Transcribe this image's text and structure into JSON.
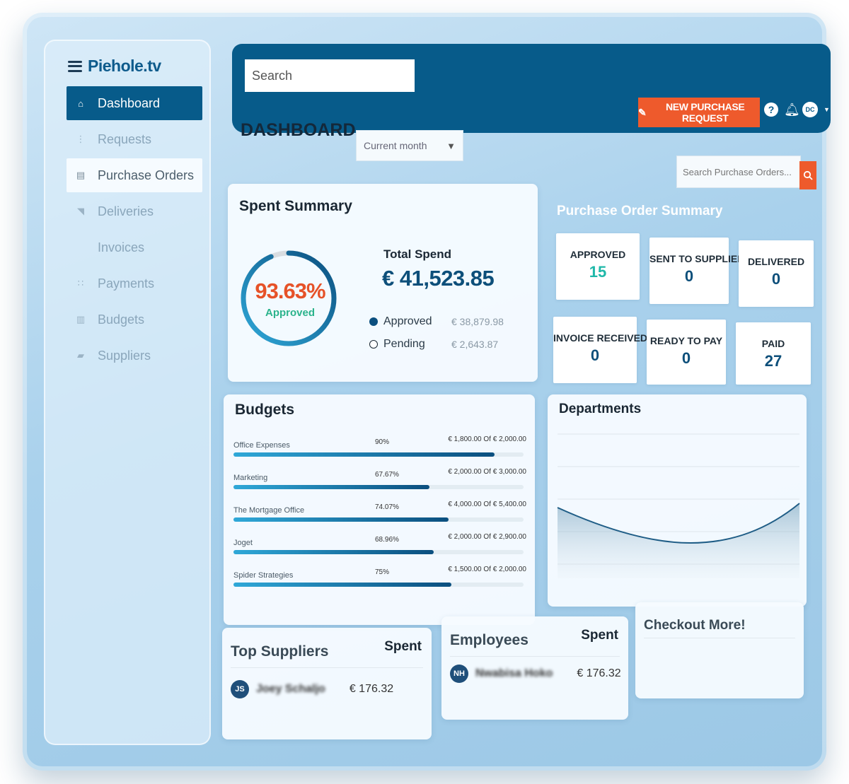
{
  "sidebar": {
    "brand": "Piehole.tv",
    "items": [
      {
        "label": "Dashboard",
        "icon": "home-icon",
        "glyph": "⌂"
      },
      {
        "label": "Requests",
        "icon": "requests-icon",
        "glyph": "⋮"
      },
      {
        "label": "Purchase Orders",
        "icon": "document-icon",
        "glyph": "▤"
      },
      {
        "label": "Deliveries",
        "icon": "deliveries-icon",
        "glyph": "◥"
      },
      {
        "label": "Invoices",
        "icon": "invoice-icon",
        "glyph": ""
      },
      {
        "label": "Payments",
        "icon": "payments-icon",
        "glyph": "∷"
      },
      {
        "label": "Budgets",
        "icon": "budgets-icon",
        "glyph": "▥"
      },
      {
        "label": "Suppliers",
        "icon": "truck-icon",
        "glyph": "▰"
      }
    ]
  },
  "topbar": {
    "search_placeholder": "Search",
    "new_request": "NEW PURCHASE REQUEST",
    "help": "?",
    "avatar": "DC"
  },
  "header": {
    "title": "DASHBOARD",
    "period": "Current month",
    "po_search_placeholder": "Search Purchase Orders..."
  },
  "spent_summary": {
    "title": "Spent Summary",
    "percent": "93.63%",
    "percent_value": 93.63,
    "percent_label": "Approved",
    "total_label": "Total Spend",
    "total_value": "€ 41,523.85",
    "legend": [
      {
        "label": "Approved",
        "value": "€ 38,879.98"
      },
      {
        "label": "Pending",
        "value": "€ 2,643.87"
      }
    ]
  },
  "po_summary": {
    "title": "Purchase Order Summary",
    "items": [
      {
        "label": "APPROVED",
        "value": "15"
      },
      {
        "label": "SENT TO SUPPLIER",
        "value": "0"
      },
      {
        "label": "DELIVERED",
        "value": "0"
      },
      {
        "label": "INVOICE RECEIVED",
        "value": "0"
      },
      {
        "label": "READY TO PAY",
        "value": "0"
      },
      {
        "label": "PAID",
        "value": "27"
      }
    ]
  },
  "budgets": {
    "title": "Budgets",
    "rows": [
      {
        "name": "Office Expenses",
        "percent": "90%",
        "fraction": 0.9,
        "amount": "€ 1,800.00 Of € 2,000.00"
      },
      {
        "name": "Marketing",
        "percent": "67.67%",
        "fraction": 0.6767,
        "amount": "€ 2,000.00 Of € 3,000.00"
      },
      {
        "name": "The Mortgage Office",
        "percent": "74.07%",
        "fraction": 0.7407,
        "amount": "€ 4,000.00 Of € 5,400.00"
      },
      {
        "name": "Joget",
        "percent": "68.96%",
        "fraction": 0.6896,
        "amount": "€ 2,000.00 Of € 2,900.00"
      },
      {
        "name": "Spider Strategies",
        "percent": "75%",
        "fraction": 0.75,
        "amount": "€ 1,500.00 Of € 2,000.00"
      }
    ]
  },
  "departments": {
    "title": "Departments"
  },
  "top_suppliers": {
    "title": "Top Suppliers",
    "spent_label": "Spent",
    "rows": [
      {
        "initials": "JS",
        "name": "Joey Schaljo",
        "spent": "€ 176.32"
      }
    ]
  },
  "employees": {
    "title": "Employees",
    "spent_label": "Spent",
    "rows": [
      {
        "initials": "NH",
        "name": "Nwabisa Hoko",
        "spent": "€ 176.32"
      }
    ]
  },
  "checkout": {
    "title": "Checkout More!"
  },
  "colors": {
    "primary": "#075b8a",
    "accent": "#ee5a2c",
    "approved_green": "#2bb38c",
    "teal": "#1fb8a9"
  }
}
